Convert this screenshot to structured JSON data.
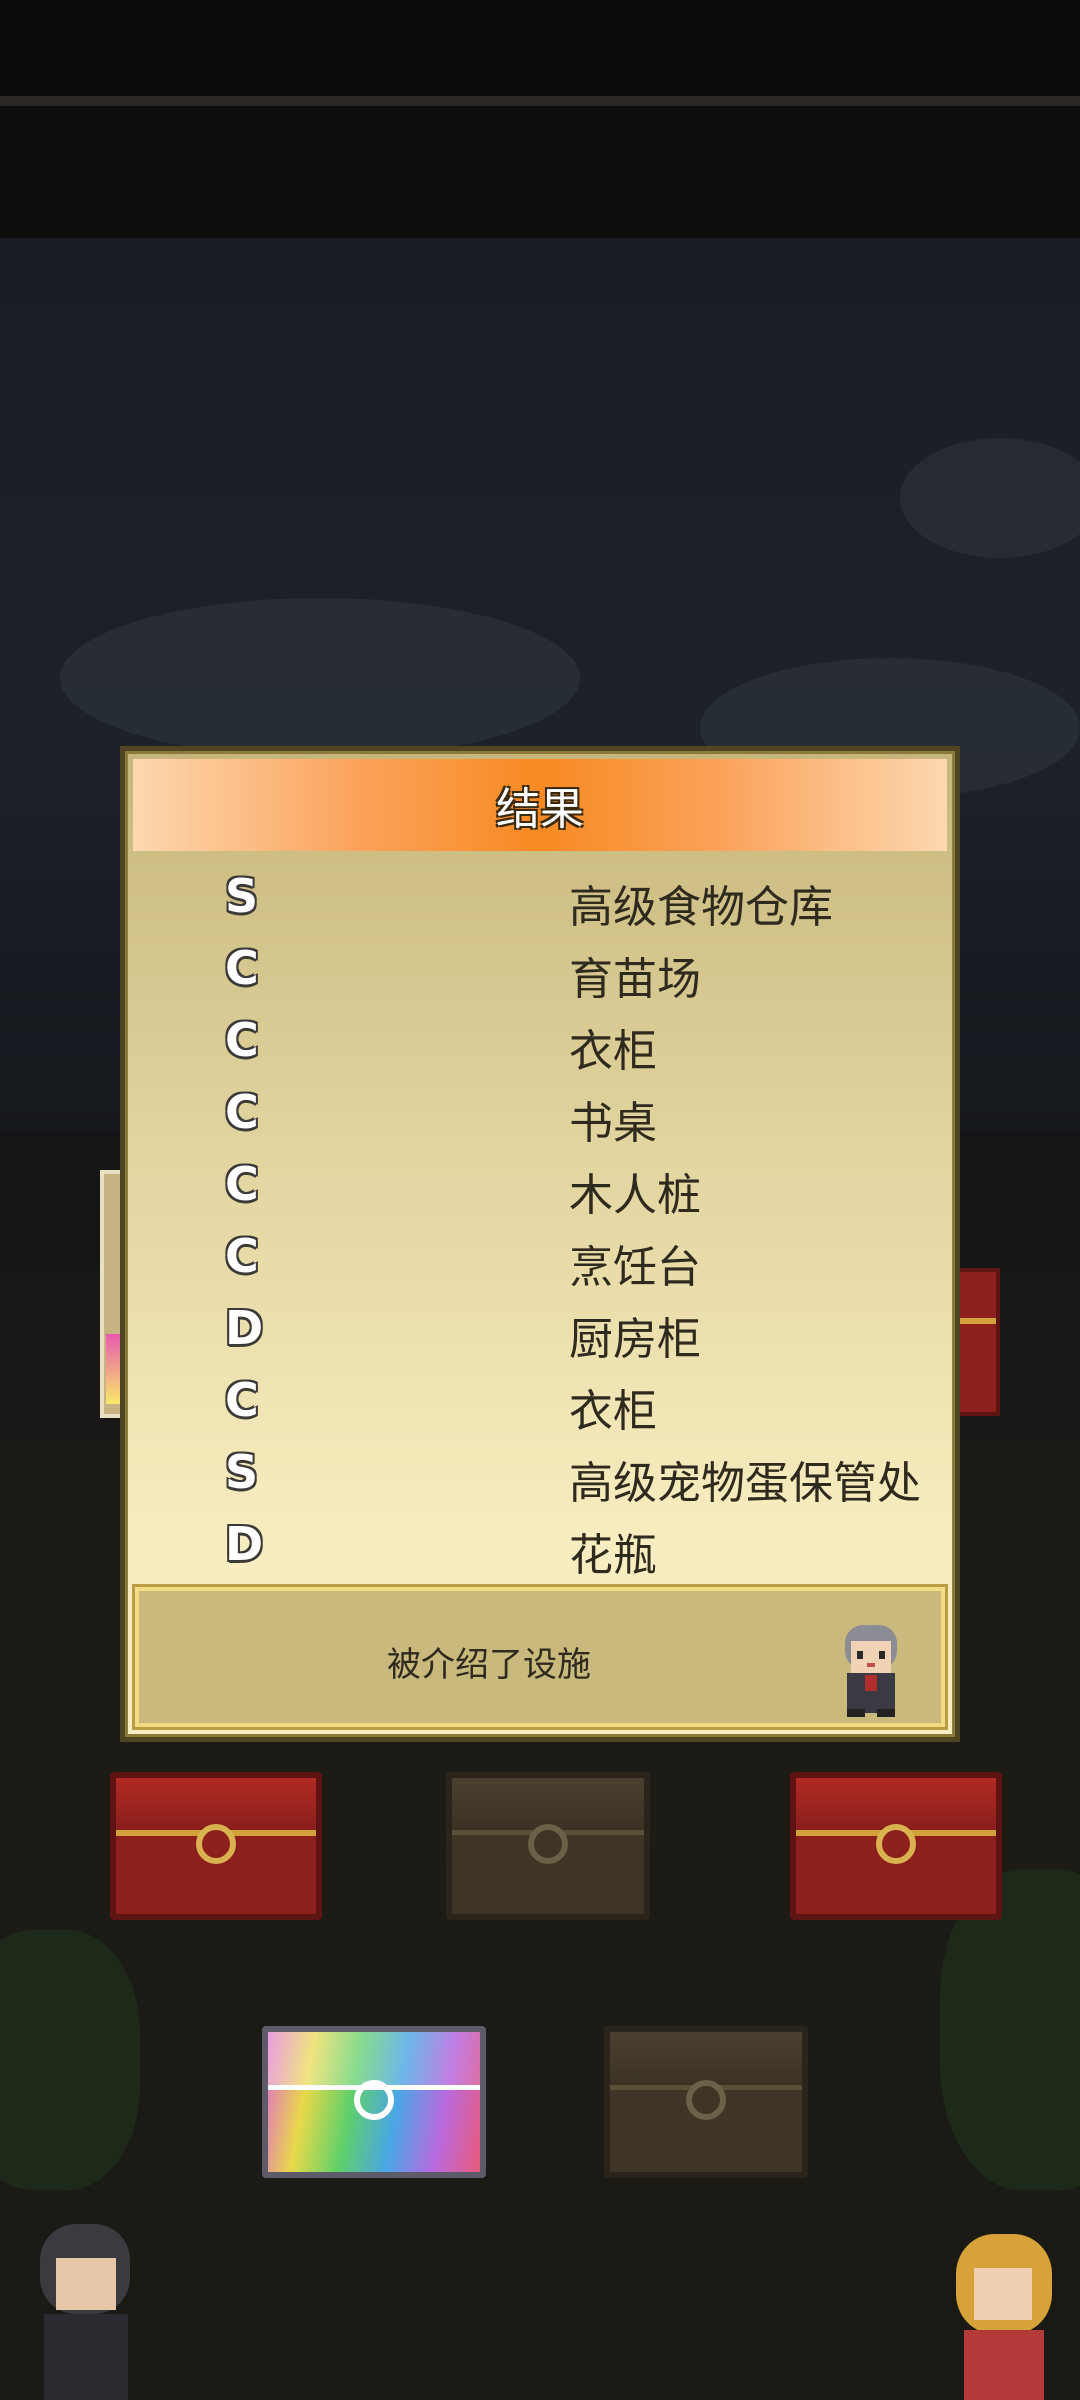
{
  "dialog": {
    "title": "结果",
    "results": [
      {
        "grade": "S",
        "facility": "高级食物仓库"
      },
      {
        "grade": "C",
        "facility": "育苗场"
      },
      {
        "grade": "C",
        "facility": "衣柜"
      },
      {
        "grade": "C",
        "facility": "书桌"
      },
      {
        "grade": "C",
        "facility": "木人桩"
      },
      {
        "grade": "C",
        "facility": "烹饪台"
      },
      {
        "grade": "D",
        "facility": "厨房柜"
      },
      {
        "grade": "C",
        "facility": "衣柜"
      },
      {
        "grade": "S",
        "facility": "高级宠物蛋保管处"
      },
      {
        "grade": "D",
        "facility": "花瓶"
      }
    ],
    "message": "被介绍了设施",
    "advisor_icon": "advisor-character-icon"
  },
  "chests": [
    {
      "type": "red",
      "icon": "red-treasure-chest-icon"
    },
    {
      "type": "brown",
      "icon": "brown-treasure-chest-icon"
    },
    {
      "type": "red",
      "icon": "red-treasure-chest-icon"
    },
    {
      "type": "rainbow",
      "icon": "rainbow-treasure-chest-icon"
    },
    {
      "type": "brown",
      "icon": "brown-treasure-chest-icon"
    }
  ],
  "colors": {
    "header_orange": "#f78a22",
    "dialog_bg": "#f8edc0",
    "chest_red": "#8d1f1c",
    "chest_brown": "#3e3526"
  }
}
